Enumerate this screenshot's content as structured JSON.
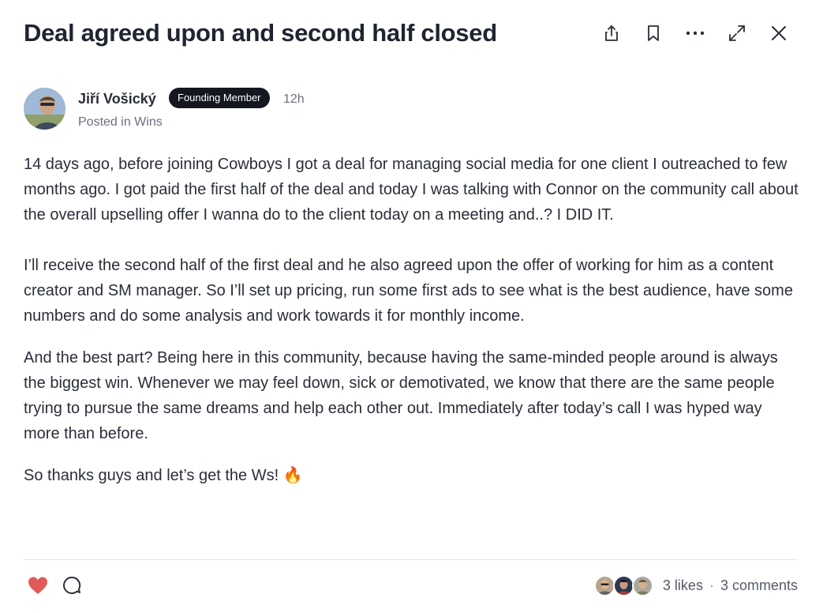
{
  "post": {
    "title": "Deal agreed upon and second half closed",
    "author": {
      "name": "Jiří Vošický",
      "badge": "Founding Member",
      "time": "12h",
      "posted_in": "Posted in Wins"
    },
    "paragraphs": [
      "14 days ago, before joining Cowboys I got a deal for managing social media for one client I outreached to few months ago. I got paid the first half of the deal and today I was talking with Connor on the community call about the overall upselling offer I wanna do to the client today on a meeting and..? I DID IT.",
      "I’ll receive the second half of the first deal and he also agreed upon the offer of working for him as a content creator and SM manager. So I’ll set up pricing, run some first ads to see what is the best audience, have some numbers and do some analysis and work towards it for monthly income.",
      "And the best part? Being here in this community, because having the same-minded people around is always the biggest win. Whenever we may feel down, sick or demotivated, we know that there are the same people trying to pursue the same dreams and help each other out. Immediately after today’s call I was hyped way more than before.",
      "So thanks guys and let’s get the Ws! 🔥"
    ]
  },
  "header_actions": {
    "icons": [
      "share-icon",
      "bookmark-icon",
      "more-icon",
      "expand-icon",
      "close-icon"
    ]
  },
  "footer": {
    "likes": "3 likes",
    "separator": "·",
    "comments": "3 comments"
  },
  "colors": {
    "heart": "#e15a5a",
    "badge_bg": "#14171f",
    "text": "#2a2e38",
    "muted": "#6b7080"
  }
}
